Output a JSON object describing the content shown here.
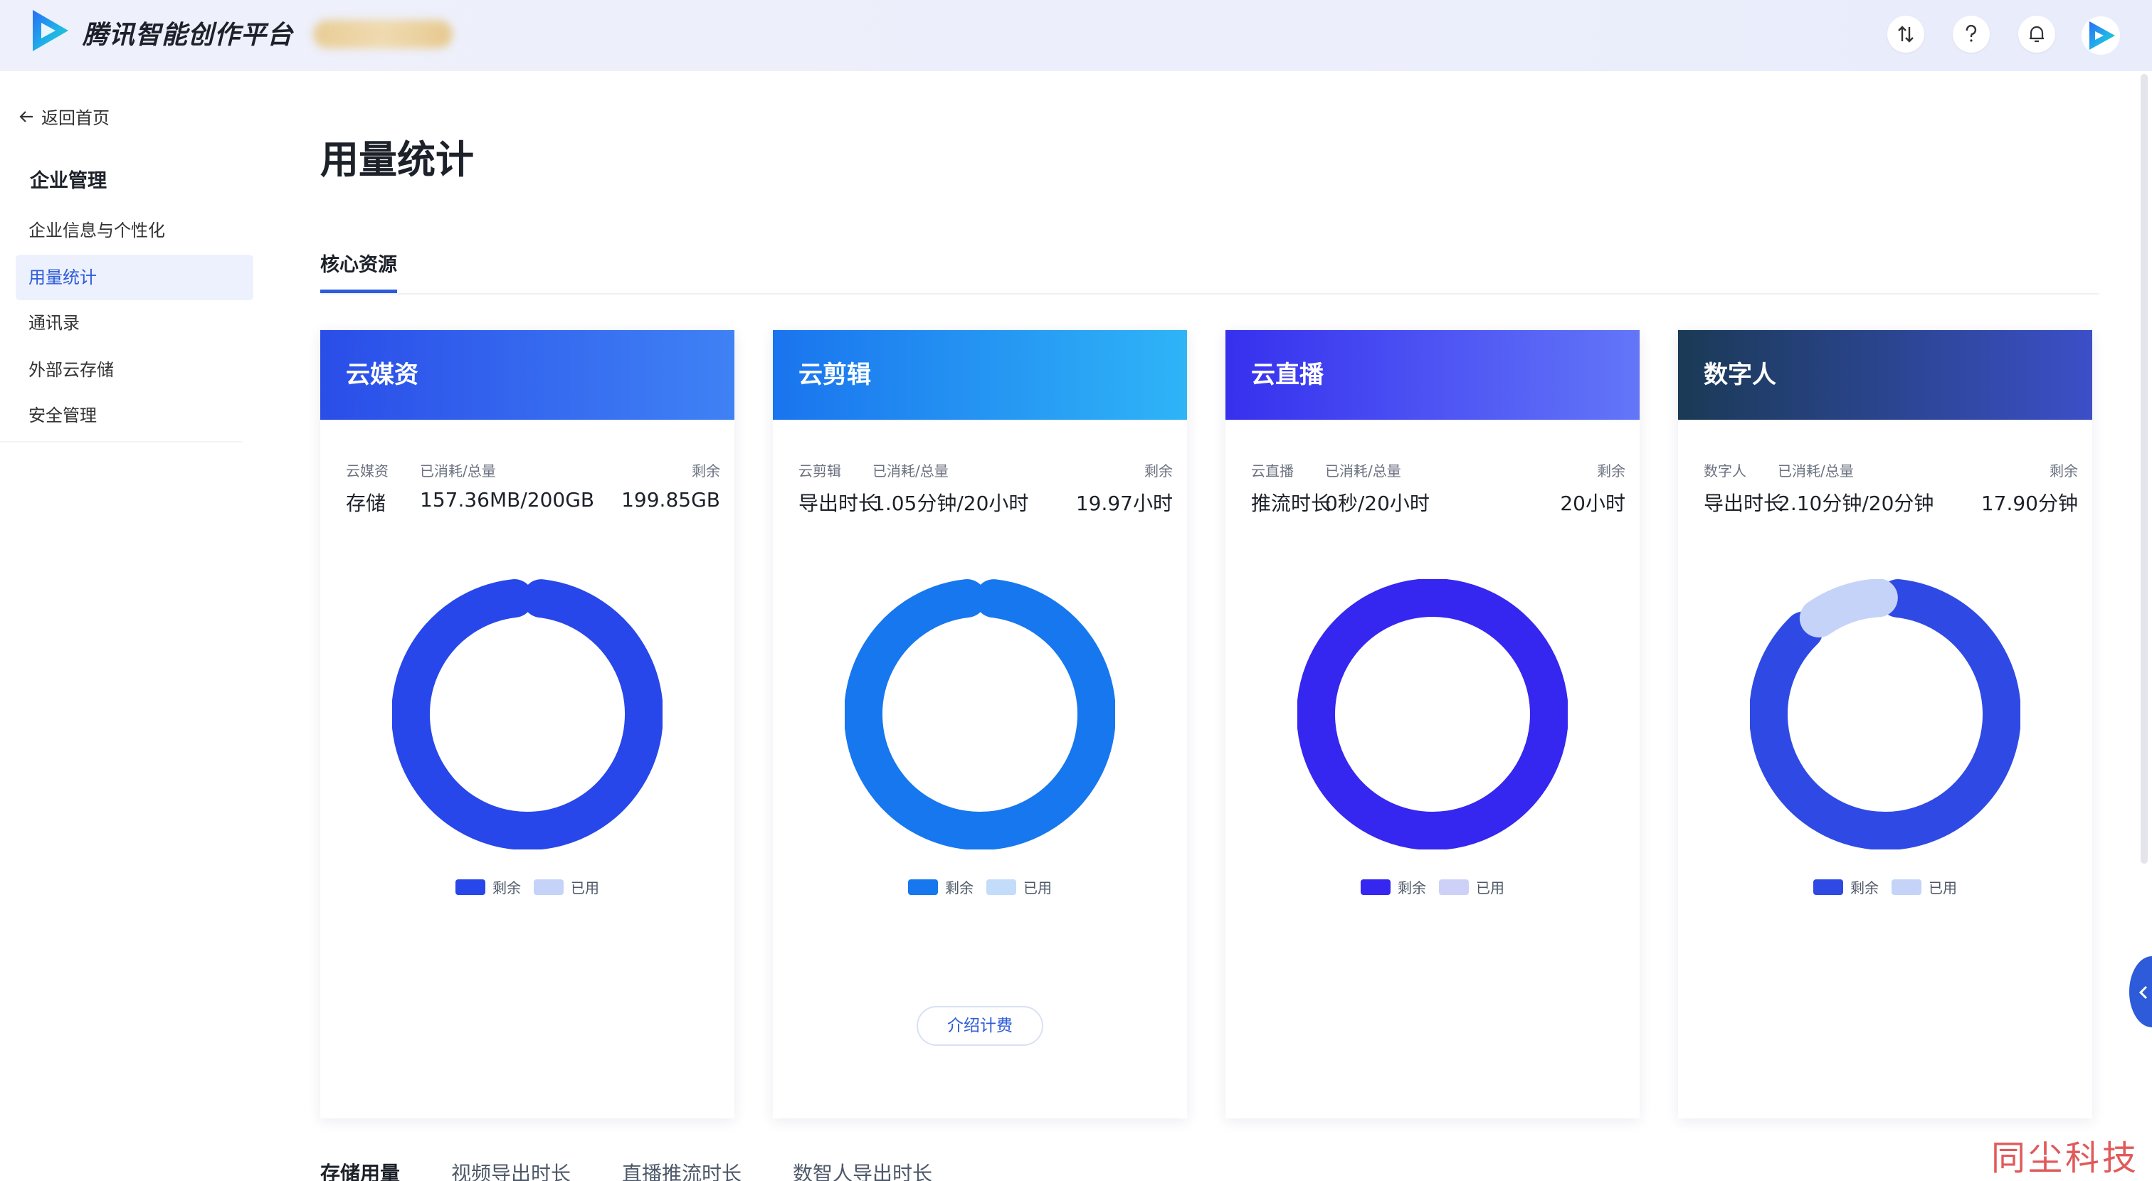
{
  "header": {
    "brand": "腾讯智能创作平台",
    "icons": [
      "sort-icon",
      "help-icon",
      "bell-icon",
      "avatar"
    ]
  },
  "sidebar": {
    "back_label": "返回首页",
    "section_title": "企业管理",
    "items": [
      {
        "label": "企业信息与个性化",
        "active": false
      },
      {
        "label": "用量统计",
        "active": true
      },
      {
        "label": "通讯录",
        "active": false
      },
      {
        "label": "外部云存储",
        "active": false
      },
      {
        "label": "安全管理",
        "active": false
      }
    ]
  },
  "main": {
    "title": "用量统计",
    "tab": "核心资源",
    "cards": [
      {
        "title": "云媒资",
        "col1_label": "云媒资",
        "col2_label": "已消耗/总量",
        "col3_label": "剩余",
        "col1_value": "存储",
        "col2_value": "157.36MB/200GB",
        "col3_value": "199.85GB",
        "used_fraction": 0.001,
        "remain_color": "#2747ea",
        "used_color": "#c5d3f8",
        "legend_remain": "剩余",
        "legend_used": "已用"
      },
      {
        "title": "云剪辑",
        "col1_label": "云剪辑",
        "col2_label": "已消耗/总量",
        "col3_label": "剩余",
        "col1_value": "导出时长",
        "col2_value": "1.05分钟/20小时",
        "col3_value": "19.97小时",
        "used_fraction": 0.001,
        "remain_color": "#1677ef",
        "used_color": "#c3dcfa",
        "legend_remain": "剩余",
        "legend_used": "已用",
        "intro_button": "介绍计费"
      },
      {
        "title": "云直播",
        "col1_label": "云直播",
        "col2_label": "已消耗/总量",
        "col3_label": "剩余",
        "col1_value": "推流时长",
        "col2_value": "0秒/20小时",
        "col3_value": "20小时",
        "used_fraction": 0,
        "remain_color": "#3526f0",
        "used_color": "#cdd1f8",
        "legend_remain": "剩余",
        "legend_used": "已用"
      },
      {
        "title": "数字人",
        "col1_label": "数字人",
        "col2_label": "已消耗/总量",
        "col3_label": "剩余",
        "col1_value": "导出时长",
        "col2_value": "2.10分钟/20分钟",
        "col3_value": "17.90分钟",
        "used_fraction": 0.105,
        "remain_color": "#2f4ae4",
        "used_color": "#c5d3f8",
        "legend_remain": "剩余",
        "legend_used": "已用"
      }
    ],
    "bottom_tabs": [
      "存储用量",
      "视频导出时长",
      "直播推流时长",
      "数智人导出时长"
    ]
  },
  "watermark": "同尘科技"
}
